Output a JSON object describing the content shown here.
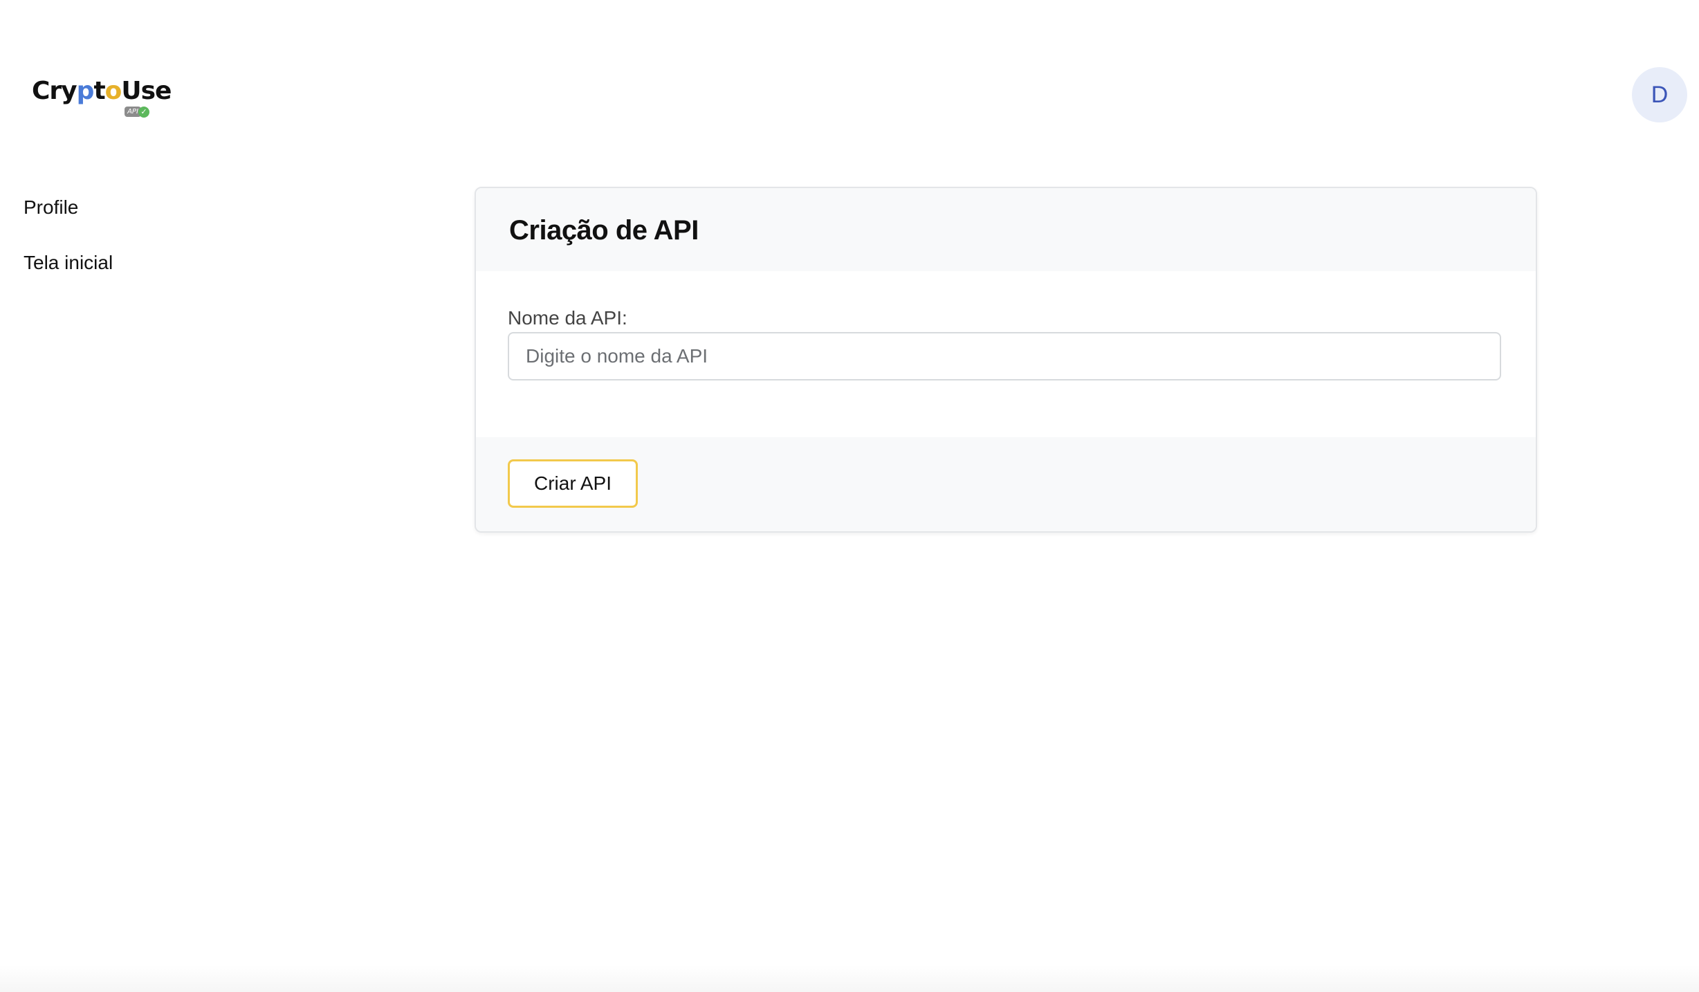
{
  "header": {
    "logo": {
      "text_parts": [
        "C",
        "ry",
        "p",
        "t",
        "o",
        "Use"
      ],
      "badge_text": "API",
      "check_glyph": "✓",
      "colors": {
        "p": "#4a7bd8",
        "o": "#e7b12a"
      }
    },
    "avatar_initial": "D"
  },
  "sidebar": {
    "items": [
      {
        "label": "Profile"
      },
      {
        "label": "Tela inicial"
      }
    ]
  },
  "card": {
    "title": "Criação de API",
    "field_label": "Nome da API:",
    "input_value": "",
    "input_placeholder": "Digite o nome da API",
    "button_label": "Criar API"
  },
  "colors": {
    "accent_border": "#f2c94c",
    "avatar_bg": "#e8edf9",
    "avatar_text": "#3b55b8",
    "card_section_bg": "#f8f9fa"
  }
}
